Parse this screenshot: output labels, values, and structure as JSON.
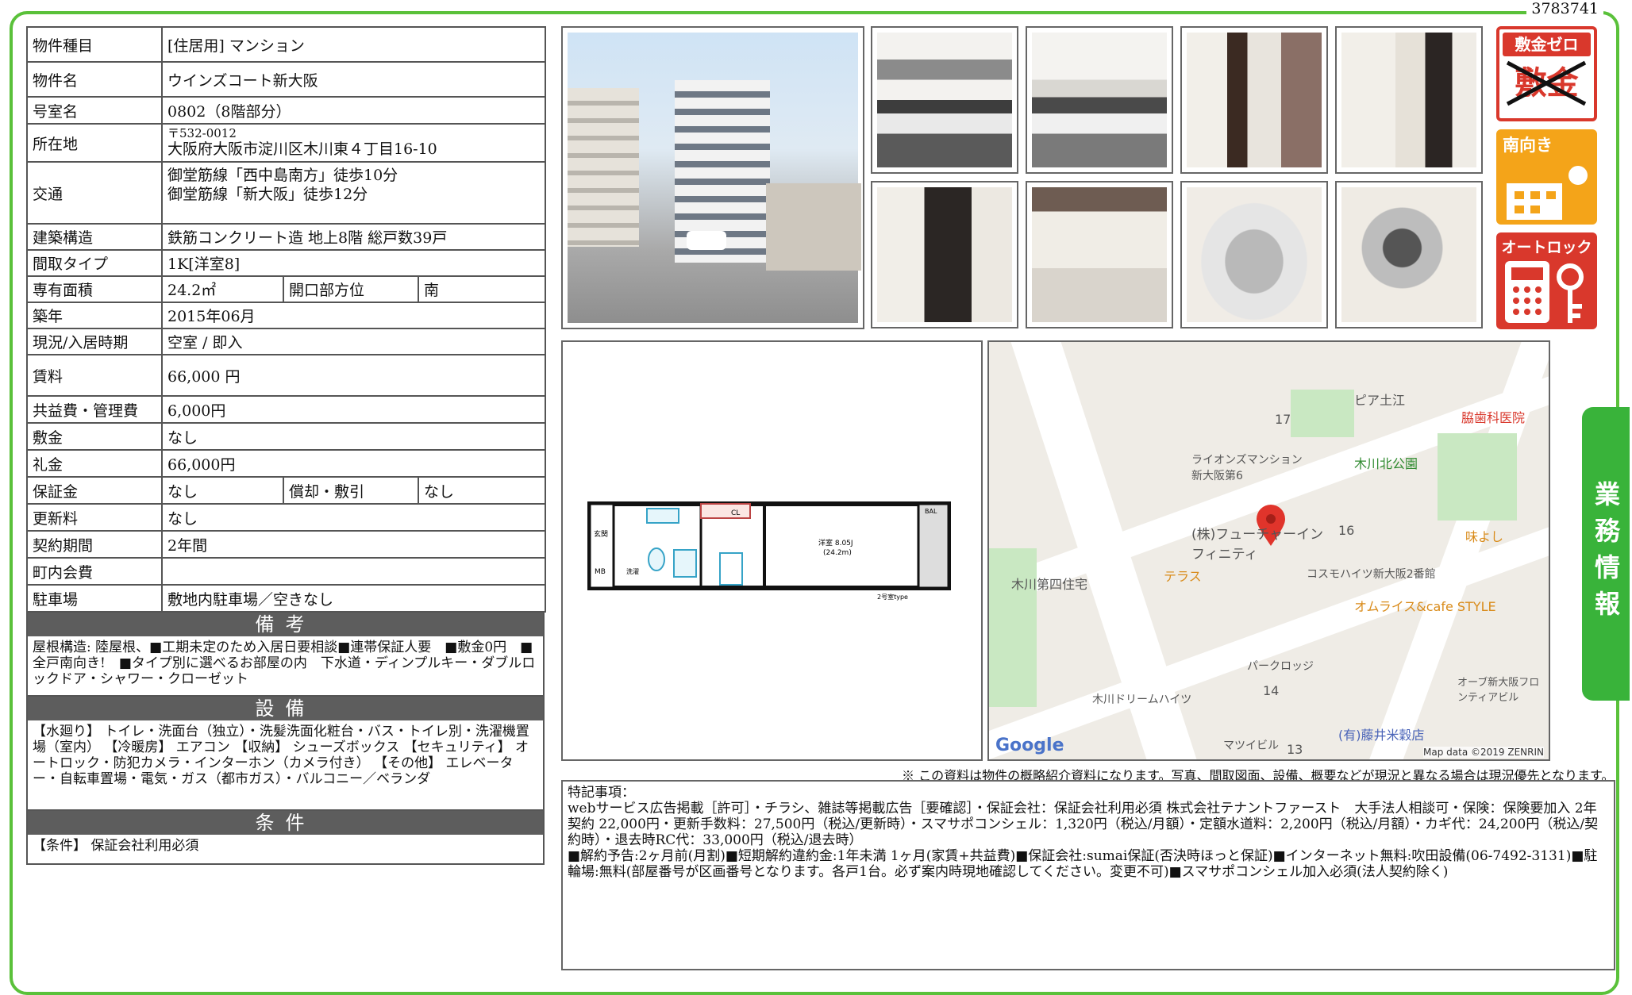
{
  "doc_id": "3783741",
  "property": {
    "type_label": "物件種目",
    "type_value": "[住居用] マンション",
    "name_label": "物件名",
    "name_value": "ウインズコート新大阪",
    "room_label": "号室名",
    "room_value": "0802（8階部分）",
    "address_label": "所在地",
    "zip": "〒532-0012",
    "address": "大阪府大阪市淀川区木川東４丁目16-10",
    "access_label": "交通",
    "access_1": "御堂筋線「西中島南方」徒歩10分",
    "access_2": "御堂筋線「新大阪」徒歩12分",
    "structure_label": "建築構造",
    "structure_value": "鉄筋コンクリート造 地上8階 総戸数39戸",
    "layout_label": "間取タイプ",
    "layout_value": "1K[洋室8]",
    "area_label": "専有面積",
    "area_value": "24.2㎡",
    "facing_label": "開口部方位",
    "facing_value": "南",
    "built_label": "築年",
    "built_value": "2015年06月",
    "status_label": "現況/入居時期",
    "status_value": "空室 / 即入",
    "rent_label": "賃料",
    "rent_value": "66,000 円",
    "fee_label": "共益費・管理費",
    "fee_value": "6,000円",
    "deposit_label": "敷金",
    "deposit_value": "なし",
    "keymoney_label": "礼金",
    "keymoney_value": "66,000円",
    "guarantee_label": "保証金",
    "guarantee_value": "なし",
    "amort_label": "償却・敷引",
    "amort_value": "なし",
    "renewal_label": "更新料",
    "renewal_value": "なし",
    "term_label": "契約期間",
    "term_value": "2年間",
    "community_label": "町内会費",
    "community_value": "",
    "parking_label": "駐車場",
    "parking_value": "敷地内駐車場／空きなし"
  },
  "sections": {
    "notes_title": "備考",
    "notes_text": "屋根構造: 陸屋根、■工期未定のため入居日要相談■連帯保証人要　■敷金0円　■全戸南向き!　■タイプ別に選べるお部屋の内　下水道・ディンプルキー・ダブルロックドア・シャワー・クローゼット",
    "equip_title": "設備",
    "equip_text": "【水廻り】 トイレ・洗面台（独立）・洗髪洗面化粧台・バス・トイレ別・洗濯機置場（室内） 【冷暖房】 エアコン 【収納】 シューズボックス 【セキュリティ】 オートロック・防犯カメラ・インターホン（カメラ付き） 【その他】 エレベーター・自転車置場・電気・ガス（都市ガス）・バルコニー／ベランダ",
    "cond_title": "条件",
    "cond_text": "【条件】 保証会社利用必須"
  },
  "badges": {
    "b1_top": "敷金ゼロ",
    "b1_main": "敷金",
    "b2": "南向き",
    "b3": "オートロック"
  },
  "floorplan": {
    "room_label": "洋室 8.05J",
    "room_area": "(24.2m)",
    "type": "2号室type",
    "bal": "BAL",
    "genkan": "玄関",
    "mb": "MB",
    "cl": "CL",
    "sen": "洗濯"
  },
  "map": {
    "labels": [
      "ピア土江",
      "17",
      "脇歯科医院",
      "ライオンズマンション新大阪第6",
      "木川北公園",
      "(株)フューチャーインフィニティ",
      "16",
      "味よし",
      "木川第四住宅",
      "テラス",
      "コスモハイツ新大阪2番館",
      "オムライス&cafe STYLE",
      "パークロッジ",
      "14",
      "木川ドリームハイツ",
      "オーブ新大阪フロンティアビル",
      "(有)藤井米穀店",
      "マツイビル",
      "13"
    ],
    "google": "Google",
    "credit": "Map data ©2019 ZENRIN"
  },
  "footnote": "※ この資料は物件の概略紹介資料になります。写真、間取図面、設備、概要などが現況と異なる場合は現況優先となります。",
  "remarks": {
    "title": "特記事項：",
    "line1": "webサービス広告掲載［許可］・チラシ、雑誌等掲載広告［要確認］・保証会社：保証会社利用必須 株式会社テナントファースト　大手法人相談可・保険：保険要加入 2年契約 22,000円・更新手数料：27,500円（税込/更新時）・スマサポコンシェル：1,320円（税込/月額）・定額水道料：2,200円（税込/月額）・カギ代：24,200円（税込/契約時）・退去時RC代：33,000円（税込/退去時）",
    "line2": "■解約予告:2ヶ月前(月割)■短期解約違約金:1年未満 1ヶ月(家賃+共益費)■保証会社:sumai保証(否決時ほっと保証)■インターネット無料:吹田設備(06-7492-3131)■駐輪場:無料(部屋番号が区画番号となります。各戸1台。必ず案内時現地確認してください。変更不可)■スマサポコンシェル加入必須(法人契約除く)"
  },
  "side_tab": "業務情報",
  "colors": {
    "frame": "#5ac13a",
    "section_bar": "#5d5d5d",
    "badge_red": "#d9382c",
    "badge_orange": "#f4a419",
    "tab": "#39b33a"
  }
}
